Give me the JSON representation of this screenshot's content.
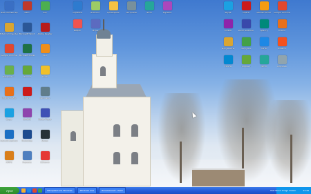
{
  "desktop": {
    "left_icons": [
      {
        "label": "Мой компьютер",
        "icon": "computer-icon",
        "color": "#3a6fc4"
      },
      {
        "label": "Total Commander",
        "icon": "folder-icon",
        "color": "#d9a531"
      },
      {
        "label": "Google Chrome",
        "icon": "chrome-icon",
        "color": "#e0482f"
      },
      {
        "label": "Notepad++",
        "icon": "document-icon",
        "color": "#6ab04c"
      },
      {
        "label": "Mozilla Firefox",
        "icon": "firefox-icon",
        "color": "#e8701a"
      },
      {
        "label": "Skype",
        "icon": "skype-icon",
        "color": "#1ba1e2"
      },
      {
        "label": "Internet Explorer",
        "icon": "ie-icon",
        "color": "#1a6fc4"
      },
      {
        "label": "AIMP3",
        "icon": "audio-icon",
        "color": "#d97f1a"
      },
      {
        "label": "Nero",
        "icon": "disc-icon",
        "color": "#c0392b"
      },
      {
        "label": "Microsoft Word",
        "icon": "word-icon",
        "color": "#2b5797"
      },
      {
        "label": "Microsoft Excel",
        "icon": "excel-icon",
        "color": "#1e7145"
      },
      {
        "label": "uTorrent",
        "icon": "torrent-icon",
        "color": "#65a83a"
      },
      {
        "label": "Opera",
        "icon": "opera-icon",
        "color": "#cc1b1b"
      },
      {
        "label": "WinRAR",
        "icon": "archive-icon",
        "color": "#8e44ad"
      },
      {
        "label": "Photoshop",
        "icon": "photoshop-icon",
        "color": "#1d4b8f"
      },
      {
        "label": "Корзина",
        "icon": "recycle-bin-icon",
        "color": "#4e7fbf"
      },
      {
        "label": "ICQ",
        "icon": "flower-icon",
        "color": "#4caf50"
      },
      {
        "label": "Adobe Reader",
        "icon": "pdf-icon",
        "color": "#b71c1c"
      },
      {
        "label": "VLC",
        "icon": "vlc-icon",
        "color": "#ef8e1a"
      },
      {
        "label": "Paint",
        "icon": "paint-icon",
        "color": "#f0c02a"
      },
      {
        "label": "Calculator",
        "icon": "calculator-icon",
        "color": "#607d8b"
      },
      {
        "label": "Media Player",
        "icon": "media-icon",
        "color": "#3f51b5"
      },
      {
        "label": "Steam",
        "icon": "game-icon",
        "color": "#263238"
      },
      {
        "label": "CCleaner",
        "icon": "cleaner-icon",
        "color": "#e53935"
      }
    ],
    "middle_icons": [
      {
        "label": "Справка",
        "icon": "help-icon",
        "color": "#2e7bcf"
      },
      {
        "label": "Блокнот",
        "icon": "notepad-icon",
        "color": "#9ccc65"
      },
      {
        "label": "Проводник",
        "icon": "explorer-icon",
        "color": "#f5c242"
      },
      {
        "label": "Настройки",
        "icon": "gear-icon",
        "color": "#78909c"
      },
      {
        "label": "Фото",
        "icon": "image-icon",
        "color": "#26a69a"
      },
      {
        "label": "Музыка",
        "icon": "music-icon",
        "color": "#ab47bc"
      },
      {
        "label": "Видео",
        "icon": "video-icon",
        "color": "#ef5350"
      },
      {
        "label": "Игры",
        "icon": "game-icon",
        "color": "#5c6bc0"
      }
    ],
    "right_icons": [
      {
        "label": "Skype",
        "icon": "skype-icon",
        "color": "#1ba1e2"
      },
      {
        "label": "Opera",
        "icon": "opera-icon",
        "color": "#cc1b1b"
      },
      {
        "label": "Mail.Ru Агент",
        "icon": "mail-icon",
        "color": "#f39c12"
      },
      {
        "label": "Google Chrome",
        "icon": "chrome-icon",
        "color": "#e0482f"
      },
      {
        "label": "Picasa",
        "icon": "photo-icon",
        "color": "#8e24aa"
      },
      {
        "label": "Punto Switcher",
        "icon": "keyboard-icon",
        "color": "#3949ab"
      },
      {
        "label": "Speccy",
        "icon": "info-icon",
        "color": "#00897b"
      },
      {
        "label": "Firefox",
        "icon": "firefox-icon",
        "color": "#e8701a"
      },
      {
        "label": "Документы",
        "icon": "folder-icon",
        "color": "#d9a531"
      },
      {
        "label": "Загрузки",
        "icon": "download-icon",
        "color": "#43a047"
      },
      {
        "label": "Сеть",
        "icon": "network-icon",
        "color": "#1e88e5"
      },
      {
        "label": "Winamp",
        "icon": "audio-icon",
        "color": "#f4511e"
      },
      {
        "label": "Почта",
        "icon": "mail-icon",
        "color": "#0288d1"
      },
      {
        "label": "Торрент",
        "icon": "torrent-icon",
        "color": "#65a83a"
      },
      {
        "label": "Фото",
        "icon": "image-icon",
        "color": "#26a69a"
      },
      {
        "label": "Корзина",
        "icon": "recycle-bin-icon",
        "color": "#90a4ae"
      }
    ]
  },
  "taskbar": {
    "start_label": "пуск",
    "tasks": [
      {
        "label": "Обозреватель Windows"
      },
      {
        "label": "Windows Live"
      },
      {
        "label": "Безымянный - Paint"
      }
    ],
    "tray_label": "Fast Stone Image Viewer",
    "clock": "22:49"
  },
  "colors": {
    "taskbar": "#245edb",
    "start": "#2e8c2a",
    "tray": "#0f96ec"
  }
}
